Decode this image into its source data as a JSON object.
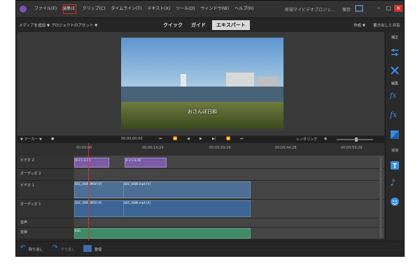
{
  "menu": [
    "ファイル(F)",
    "編集(E)",
    "クリップ(C)",
    "タイムライン(T)",
    "テキスト(X)",
    "ツール(O)",
    "ウィンドウ(W)",
    "ヘルプ(H)"
  ],
  "menu_active_index": 1,
  "project_title": "新規マイビデオプロジェ...",
  "save_label": "保存",
  "toolbar": {
    "add_media": "メディアを追加 ▼",
    "project_preset": "プロジェクトのアセット ▼",
    "modes": [
      "クイック",
      "ガイド",
      "エキスパート"
    ],
    "active_mode": "エキスパート",
    "create": "作成 ▼",
    "export_share": "書き出しと共有"
  },
  "preview": {
    "caption": "おさんぽ日和"
  },
  "sidebar": {
    "labels": [
      "補正",
      "編集",
      "追加"
    ]
  },
  "controls": {
    "marker": "▼ マーカー ▼",
    "timecode": "00;00;00;00",
    "rendering": "レンダリング"
  },
  "ruler": [
    "00;00;00",
    "00;00;14;29",
    "00;00;29;29",
    "00;00;44;28",
    "00;00;59;28"
  ],
  "tracks": [
    {
      "name": "ビデオ 2"
    },
    {
      "name": "オーディオ 2"
    },
    {
      "name": "ビデオ 1"
    },
    {
      "name": "オーディオ 1"
    },
    {
      "name": "音声"
    },
    {
      "name": "音楽"
    }
  ],
  "clips": {
    "title1": "タイトル 01",
    "title2": "タイトル 02",
    "vid1": "DSC_0085.MOV [V]",
    "vid2": "DSC_0086.mp4 [V]",
    "aud1": "DSC_0085.MOV [A]",
    "aud2": "DSC_0086.mp4 [A]",
    "music": "Kids"
  },
  "bottom": {
    "undo": "取り消し",
    "redo": "やり直し",
    "organizer": "整理"
  },
  "colors": {
    "accent_red": "#e0261e",
    "title_clip": "#7b5aa6",
    "video_clip": "#4d6f96",
    "music_clip": "#3f8a69"
  }
}
